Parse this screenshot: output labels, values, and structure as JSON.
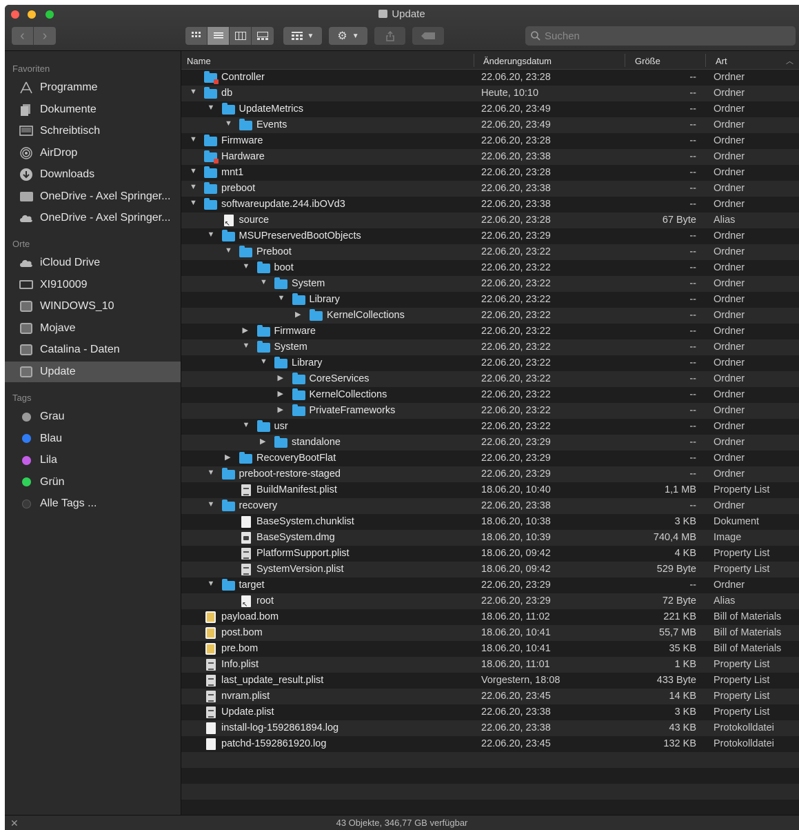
{
  "window": {
    "title": "Update"
  },
  "toolbar": {
    "back_icon": "‹",
    "forward_icon": "›",
    "search_placeholder": "Suchen"
  },
  "sidebar": {
    "sections": [
      {
        "title": "Favoriten",
        "items": [
          {
            "label": "Programme",
            "icon": "apps-icon"
          },
          {
            "label": "Dokumente",
            "icon": "documents-icon"
          },
          {
            "label": "Schreibtisch",
            "icon": "desktop-icon"
          },
          {
            "label": "AirDrop",
            "icon": "airdrop-icon"
          },
          {
            "label": "Downloads",
            "icon": "downloads-icon"
          },
          {
            "label": "OneDrive - Axel Springer...",
            "icon": "folder-icon"
          },
          {
            "label": "OneDrive - Axel Springer...",
            "icon": "cloud-icon"
          }
        ]
      },
      {
        "title": "Orte",
        "items": [
          {
            "label": "iCloud Drive",
            "icon": "cloud-icon"
          },
          {
            "label": "XI910009",
            "icon": "laptop-icon"
          },
          {
            "label": "WINDOWS_10",
            "icon": "drive-icon"
          },
          {
            "label": "Mojave",
            "icon": "drive-icon"
          },
          {
            "label": "Catalina - Daten",
            "icon": "drive-icon"
          },
          {
            "label": "Update",
            "icon": "drive-icon",
            "selected": true
          }
        ]
      },
      {
        "title": "Tags",
        "items": [
          {
            "label": "Grau",
            "icon": "tag-dot-icon",
            "color": "#9a9a9a"
          },
          {
            "label": "Blau",
            "icon": "tag-dot-icon",
            "color": "#2f7cf6"
          },
          {
            "label": "Lila",
            "icon": "tag-dot-icon",
            "color": "#c45ee9"
          },
          {
            "label": "Grün",
            "icon": "tag-dot-icon",
            "color": "#2fd158"
          },
          {
            "label": "Alle Tags ...",
            "icon": "all-tags-icon",
            "color": "#5a5a5a"
          }
        ]
      }
    ]
  },
  "columns": {
    "name": "Name",
    "date": "Änderungsdatum",
    "size": "Größe",
    "kind": "Art"
  },
  "files": [
    {
      "level": 0,
      "disc": "",
      "icon": "folder-badge",
      "name": "Controller",
      "date": "22.06.20, 23:28",
      "size": "--",
      "kind": "Ordner"
    },
    {
      "level": 0,
      "disc": "open",
      "icon": "folder",
      "name": "db",
      "date": "Heute, 10:10",
      "size": "--",
      "kind": "Ordner"
    },
    {
      "level": 1,
      "disc": "open",
      "icon": "folder",
      "name": "UpdateMetrics",
      "date": "22.06.20, 23:49",
      "size": "--",
      "kind": "Ordner"
    },
    {
      "level": 2,
      "disc": "open",
      "icon": "folder",
      "name": "Events",
      "date": "22.06.20, 23:49",
      "size": "--",
      "kind": "Ordner"
    },
    {
      "level": 0,
      "disc": "open",
      "icon": "folder",
      "name": "Firmware",
      "date": "22.06.20, 23:28",
      "size": "--",
      "kind": "Ordner"
    },
    {
      "level": 0,
      "disc": "",
      "icon": "folder-badge",
      "name": "Hardware",
      "date": "22.06.20, 23:38",
      "size": "--",
      "kind": "Ordner"
    },
    {
      "level": 0,
      "disc": "open",
      "icon": "folder",
      "name": "mnt1",
      "date": "22.06.20, 23:28",
      "size": "--",
      "kind": "Ordner"
    },
    {
      "level": 0,
      "disc": "open",
      "icon": "folder",
      "name": "preboot",
      "date": "22.06.20, 23:38",
      "size": "--",
      "kind": "Ordner"
    },
    {
      "level": 0,
      "disc": "open",
      "icon": "folder",
      "name": "softwareupdate.244.ibOVd3",
      "date": "22.06.20, 23:38",
      "size": "--",
      "kind": "Ordner"
    },
    {
      "level": 1,
      "disc": "",
      "icon": "alias",
      "name": "source",
      "date": "22.06.20, 23:28",
      "size": "67 Byte",
      "kind": "Alias"
    },
    {
      "level": 1,
      "disc": "open",
      "icon": "folder",
      "name": "MSUPreservedBootObjects",
      "date": "22.06.20, 23:29",
      "size": "--",
      "kind": "Ordner"
    },
    {
      "level": 2,
      "disc": "open",
      "icon": "folder",
      "name": "Preboot",
      "date": "22.06.20, 23:22",
      "size": "--",
      "kind": "Ordner"
    },
    {
      "level": 3,
      "disc": "open",
      "icon": "folder",
      "name": "boot",
      "date": "22.06.20, 23:22",
      "size": "--",
      "kind": "Ordner"
    },
    {
      "level": 4,
      "disc": "open",
      "icon": "folder",
      "name": "System",
      "date": "22.06.20, 23:22",
      "size": "--",
      "kind": "Ordner"
    },
    {
      "level": 5,
      "disc": "open",
      "icon": "folder",
      "name": "Library",
      "date": "22.06.20, 23:22",
      "size": "--",
      "kind": "Ordner"
    },
    {
      "level": 6,
      "disc": "closed",
      "icon": "folder",
      "name": "KernelCollections",
      "date": "22.06.20, 23:22",
      "size": "--",
      "kind": "Ordner"
    },
    {
      "level": 3,
      "disc": "closed",
      "icon": "folder",
      "name": "Firmware",
      "date": "22.06.20, 23:22",
      "size": "--",
      "kind": "Ordner"
    },
    {
      "level": 3,
      "disc": "open",
      "icon": "folder",
      "name": "System",
      "date": "22.06.20, 23:22",
      "size": "--",
      "kind": "Ordner"
    },
    {
      "level": 4,
      "disc": "open",
      "icon": "folder",
      "name": "Library",
      "date": "22.06.20, 23:22",
      "size": "--",
      "kind": "Ordner"
    },
    {
      "level": 5,
      "disc": "closed",
      "icon": "folder",
      "name": "CoreServices",
      "date": "22.06.20, 23:22",
      "size": "--",
      "kind": "Ordner"
    },
    {
      "level": 5,
      "disc": "closed",
      "icon": "folder",
      "name": "KernelCollections",
      "date": "22.06.20, 23:22",
      "size": "--",
      "kind": "Ordner"
    },
    {
      "level": 5,
      "disc": "closed",
      "icon": "folder",
      "name": "PrivateFrameworks",
      "date": "22.06.20, 23:22",
      "size": "--",
      "kind": "Ordner"
    },
    {
      "level": 3,
      "disc": "open",
      "icon": "folder",
      "name": "usr",
      "date": "22.06.20, 23:22",
      "size": "--",
      "kind": "Ordner"
    },
    {
      "level": 4,
      "disc": "closed",
      "icon": "folder",
      "name": "standalone",
      "date": "22.06.20, 23:29",
      "size": "--",
      "kind": "Ordner"
    },
    {
      "level": 2,
      "disc": "closed",
      "icon": "folder",
      "name": "RecoveryBootFlat",
      "date": "22.06.20, 23:29",
      "size": "--",
      "kind": "Ordner"
    },
    {
      "level": 1,
      "disc": "open",
      "icon": "folder",
      "name": "preboot-restore-staged",
      "date": "22.06.20, 23:29",
      "size": "--",
      "kind": "Ordner"
    },
    {
      "level": 2,
      "disc": "",
      "icon": "plist",
      "name": "BuildManifest.plist",
      "date": "18.06.20, 10:40",
      "size": "1,1 MB",
      "kind": "Property List"
    },
    {
      "level": 1,
      "disc": "open",
      "icon": "folder",
      "name": "recovery",
      "date": "22.06.20, 23:38",
      "size": "--",
      "kind": "Ordner"
    },
    {
      "level": 2,
      "disc": "",
      "icon": "doc",
      "name": "BaseSystem.chunklist",
      "date": "18.06.20, 10:38",
      "size": "3 KB",
      "kind": "Dokument"
    },
    {
      "level": 2,
      "disc": "",
      "icon": "dmg",
      "name": "BaseSystem.dmg",
      "date": "18.06.20, 10:39",
      "size": "740,4 MB",
      "kind": "Image"
    },
    {
      "level": 2,
      "disc": "",
      "icon": "plist",
      "name": "PlatformSupport.plist",
      "date": "18.06.20, 09:42",
      "size": "4 KB",
      "kind": "Property List"
    },
    {
      "level": 2,
      "disc": "",
      "icon": "plist",
      "name": "SystemVersion.plist",
      "date": "18.06.20, 09:42",
      "size": "529 Byte",
      "kind": "Property List"
    },
    {
      "level": 1,
      "disc": "open",
      "icon": "folder",
      "name": "target",
      "date": "22.06.20, 23:29",
      "size": "--",
      "kind": "Ordner"
    },
    {
      "level": 2,
      "disc": "",
      "icon": "alias",
      "name": "root",
      "date": "22.06.20, 23:29",
      "size": "72 Byte",
      "kind": "Alias"
    },
    {
      "level": 0,
      "disc": "",
      "icon": "bom",
      "name": "payload.bom",
      "date": "18.06.20, 11:02",
      "size": "221 KB",
      "kind": "Bill of Materials"
    },
    {
      "level": 0,
      "disc": "",
      "icon": "bom",
      "name": "post.bom",
      "date": "18.06.20, 10:41",
      "size": "55,7 MB",
      "kind": "Bill of Materials"
    },
    {
      "level": 0,
      "disc": "",
      "icon": "bom",
      "name": "pre.bom",
      "date": "18.06.20, 10:41",
      "size": "35 KB",
      "kind": "Bill of Materials"
    },
    {
      "level": 0,
      "disc": "",
      "icon": "plist",
      "name": "Info.plist",
      "date": "18.06.20, 11:01",
      "size": "1 KB",
      "kind": "Property List"
    },
    {
      "level": 0,
      "disc": "",
      "icon": "plist",
      "name": "last_update_result.plist",
      "date": "Vorgestern, 18:08",
      "size": "433 Byte",
      "kind": "Property List"
    },
    {
      "level": 0,
      "disc": "",
      "icon": "plist",
      "name": "nvram.plist",
      "date": "22.06.20, 23:45",
      "size": "14 KB",
      "kind": "Property List"
    },
    {
      "level": 0,
      "disc": "",
      "icon": "plist",
      "name": "Update.plist",
      "date": "22.06.20, 23:38",
      "size": "3 KB",
      "kind": "Property List"
    },
    {
      "level": 0,
      "disc": "",
      "icon": "doc",
      "name": "install-log-1592861894.log",
      "date": "22.06.20, 23:38",
      "size": "43 KB",
      "kind": "Protokolldatei"
    },
    {
      "level": 0,
      "disc": "",
      "icon": "doc",
      "name": "patchd-1592861920.log",
      "date": "22.06.20, 23:45",
      "size": "132 KB",
      "kind": "Protokolldatei"
    }
  ],
  "status": {
    "text": "43 Objekte, 346,77 GB verfügbar"
  }
}
